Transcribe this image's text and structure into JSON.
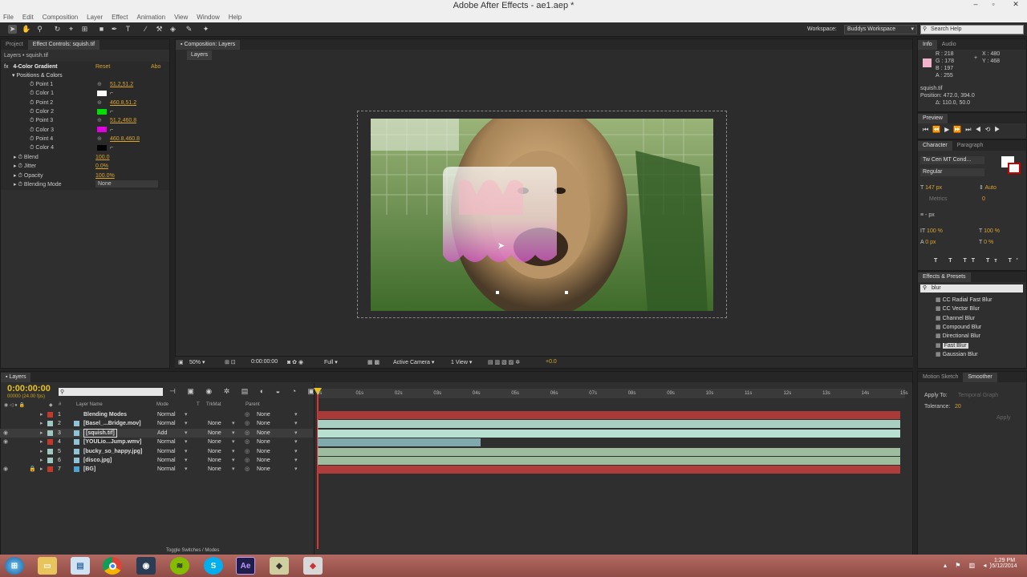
{
  "app": {
    "title": "Adobe After Effects - ae1.aep *"
  },
  "menu": [
    "File",
    "Edit",
    "Composition",
    "Layer",
    "Effect",
    "Animation",
    "View",
    "Window",
    "Help"
  ],
  "toolbar": {
    "workspace_label": "Workspace:",
    "workspace_value": "Buddys Workspace",
    "search_placeholder": "Search Help"
  },
  "left_panel": {
    "tabs": [
      "Project",
      "Effect Controls: squish.tif"
    ],
    "breadcrumb": "Layers • squish.tif",
    "effect": {
      "name": "4-Color Gradient",
      "reset": "Reset",
      "about": "Abo"
    },
    "group": "Positions & Colors",
    "params": [
      {
        "label": "Point 1",
        "value": "51.2,51.2",
        "type": "point"
      },
      {
        "label": "Color 1",
        "color": "#ffffff",
        "type": "color"
      },
      {
        "label": "Point 2",
        "value": "460.8,51.2",
        "type": "point"
      },
      {
        "label": "Color 2",
        "color": "#00e000",
        "type": "color"
      },
      {
        "label": "Point 3",
        "value": "51.2,460.8",
        "type": "point"
      },
      {
        "label": "Color 3",
        "color": "#e000e0",
        "type": "color"
      },
      {
        "label": "Point 4",
        "value": "460.8,460.8",
        "type": "point"
      },
      {
        "label": "Color 4",
        "color": "#000000",
        "type": "color"
      }
    ],
    "extra": [
      {
        "label": "Blend",
        "value": "100.0"
      },
      {
        "label": "Jitter",
        "value": "0.0%"
      },
      {
        "label": "Opacity",
        "value": "100.0%"
      },
      {
        "label": "Blending Mode",
        "value": "None"
      }
    ]
  },
  "comp": {
    "tab": "Composition: Layers",
    "subtab": "Layers",
    "footer": {
      "zoom": "50%",
      "timecode": "0:00:00:00",
      "resolution": "Full",
      "camera": "Active Camera",
      "views": "1 View",
      "exposure": "+0.0"
    }
  },
  "info": {
    "tabs": [
      "Info",
      "Audio"
    ],
    "r": "R : 218",
    "g": "G : 178",
    "b": "B : 197",
    "a": "A : 255",
    "x": "X : 480",
    "y": "Y : 468",
    "layer": "squish.tif",
    "position": "Position: 472.0, 394.0",
    "delta": "Δ: 110.0, 50.0",
    "swatch": "#f2b4cc"
  },
  "preview": {
    "tab": "Preview"
  },
  "character": {
    "tabs": [
      "Character",
      "Paragraph"
    ],
    "font": "Tw Cen MT Cond...",
    "style": "Regular",
    "size": "147 px",
    "leading": "Auto",
    "metrics": "Metrics",
    "tracking": "0",
    "stroke": "px",
    "vscale": "100 %",
    "hscale": "100 %",
    "baseline": "0 px",
    "tsume": "0 %"
  },
  "effects_presets": {
    "tab": "Effects & Presets",
    "search": "blur",
    "items": [
      "CC Radial Fast Blur",
      "CC Vector Blur",
      "Channel Blur",
      "Compound Blur",
      "Directional Blur",
      "Fast Blur",
      "Gaussian Blur"
    ],
    "selected": "Fast Blur"
  },
  "smoother": {
    "tabs": [
      "Motion Sketch",
      "Smoother"
    ],
    "apply_to_label": "Apply To:",
    "apply_to_value": "Temporal Graph",
    "tolerance_label": "Tolerance:",
    "tolerance_value": "20",
    "apply": "Apply"
  },
  "timeline": {
    "tab": "Layers",
    "timecode": "0:00:00:00",
    "timecode_sub": "00000 (24.00 fps)",
    "headers": {
      "num": "#",
      "name": "Layer Name",
      "mode": "Mode",
      "t": "T",
      "trkmat": "TrkMat",
      "parent": "Parent"
    },
    "ruler": [
      "0s",
      "01s",
      "02s",
      "03s",
      "04s",
      "05s",
      "06s",
      "07s",
      "08s",
      "09s",
      "10s",
      "11s",
      "12s",
      "13s",
      "14s",
      "15s"
    ],
    "layers": [
      {
        "num": "1",
        "name": "Blending Modes",
        "mode": "Normal",
        "trkmat": "",
        "parent": "None",
        "label": "#c0392b",
        "bar": "#a83a3a",
        "end": 1.0
      },
      {
        "num": "2",
        "name": "[Basel_...Bridge.mov]",
        "mode": "Normal",
        "trkmat": "None",
        "parent": "None",
        "label": "#9fc9c0",
        "bar": "#a9cfc3",
        "end": 1.0
      },
      {
        "num": "3",
        "name": "[squish.tif]",
        "mode": "Add",
        "trkmat": "None",
        "parent": "None",
        "label": "#9fc9c0",
        "bar": "#b8e0d0",
        "end": 1.0
      },
      {
        "num": "4",
        "name": "[YOULio...Jump.wmv]",
        "mode": "Normal",
        "trkmat": "None",
        "parent": "None",
        "label": "#c0392b",
        "bar": "#7fa9ad",
        "end": 0.28
      },
      {
        "num": "5",
        "name": "[bucky_so_happy.jpg]",
        "mode": "Normal",
        "trkmat": "None",
        "parent": "None",
        "label": "#9fc9c0",
        "bar": "#9ebd9e",
        "end": 1.0
      },
      {
        "num": "6",
        "name": "[disco.jpg]",
        "mode": "Normal",
        "trkmat": "None",
        "parent": "None",
        "label": "#9fc9c0",
        "bar": "#9ebd9e",
        "end": 1.0
      },
      {
        "num": "7",
        "name": "[BG]",
        "mode": "Normal",
        "trkmat": "None",
        "parent": "None",
        "label": "#c0392b",
        "bar": "#b03c3c",
        "end": 1.0
      }
    ],
    "footer": "Toggle Switches / Modes"
  },
  "taskbar": {
    "time": "1:29 PM",
    "date": "5/12/2014",
    "icons": [
      "start-orb-icon",
      "file-explorer-icon",
      "documents-icon",
      "chrome-icon",
      "steam-icon",
      "spotify-icon",
      "skype-icon",
      "after-effects-icon",
      "app-icon-1",
      "app-icon-2"
    ]
  }
}
